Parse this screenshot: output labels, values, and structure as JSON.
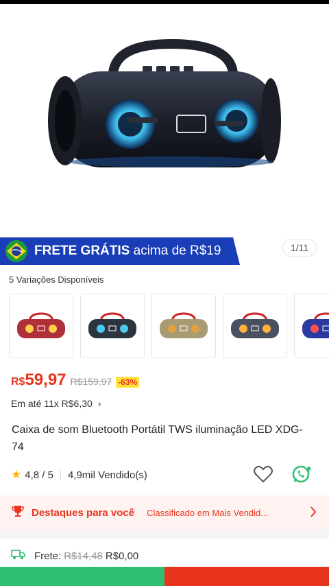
{
  "gallery": {
    "counter": "1/11"
  },
  "banner": {
    "prefix": "FRETE GRÁTIS",
    "suffix": "acima de R$19"
  },
  "variations": {
    "label": "5 Variações Disponíveis",
    "items": [
      {
        "color": "#b0303a"
      },
      {
        "color": "#2c3440"
      },
      {
        "color": "#a89a72"
      },
      {
        "color": "#4a5060"
      },
      {
        "color": "#2a3aa0"
      }
    ]
  },
  "price": {
    "currency": "R$",
    "value": "59,97",
    "old": "R$159,97",
    "discount": "-63%",
    "installment": "Em até 11x R$6,30"
  },
  "product": {
    "title": "Caixa de som Bluetooth Portátil TWS iluminação LED XDG-74"
  },
  "rating": {
    "score": "4,8 / 5",
    "sold": "4,9mil Vendido(s)"
  },
  "highlights": {
    "title": "Destaques para você",
    "subtitle": "Classificado em Mais Vendid..."
  },
  "shipping": {
    "label": "Frete:",
    "old": "R$14,48",
    "value": "R$0,00"
  },
  "colors": {
    "accent": "#e8341d",
    "banner": "#1a3db8",
    "whatsapp": "#2fbf71"
  }
}
